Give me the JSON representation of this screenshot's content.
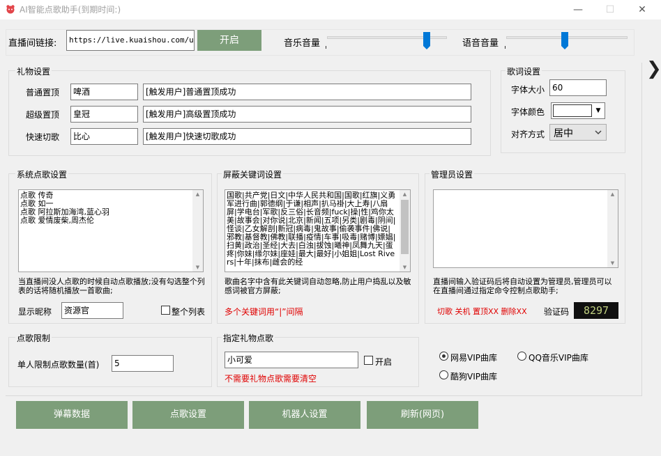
{
  "window": {
    "title": "AI智能点歌助手(到期时间:)",
    "minimize": "—",
    "maximize": "☐",
    "close": "✕"
  },
  "topbar": {
    "url_label": "直播间链接:",
    "url_value": "https://live.kuaishou.com/u/3x",
    "start_button": "开启",
    "music_volume_label": "音乐音量",
    "voice_volume_label": "语音音量",
    "music_volume_level": 0.85,
    "voice_volume_level": 0.48
  },
  "side_arrow": "❯",
  "gift_settings": {
    "title": "礼物设置",
    "rows": [
      {
        "label": "普通置顶",
        "gift": "啤酒",
        "message": "[触发用户]普通置顶成功"
      },
      {
        "label": "超级置顶",
        "gift": "皇冠",
        "message": "[触发用户]高级置顶成功"
      },
      {
        "label": "快速切歌",
        "gift": "比心",
        "message": "[触发用户]快速切歌成功"
      }
    ]
  },
  "lyrics_settings": {
    "title": "歌词设置",
    "font_size_label": "字体大小",
    "font_size_value": "60",
    "font_color_label": "字体颜色",
    "align_label": "对齐方式",
    "align_value": "居中"
  },
  "system_songs": {
    "title": "系统点歌设置",
    "lines": [
      "点歌 传奇",
      "点歌 如一",
      "点歌 阿拉斯加海湾,蓝心羽",
      "点歌 爱情废柴,周杰伦"
    ],
    "hint": "当直播间没人点歌的时候自动点歌播放;没有勾选整个列表的话将随机播放一首歌曲;",
    "nickname_label": "显示昵称",
    "nickname_value": "资源官",
    "whole_list_label": "整个列表"
  },
  "blocked_keywords": {
    "title": "屏蔽关键词设置",
    "text": "国歌|共产党|日文|中华人民共和国|国歌|红旗|义勇军进行曲|郭德纲|于谦|相声|扒马褂|大上寿|八扇屏|学电台|军歌|反三俗|长音频|fuck|操|性|鸡你太美|故事会|对你说|北京|新闻|五项|另类|剧毒|阴间|怪谈|乙女解剖|新冠|病毒|鬼故事|偷袭事件|佛说|邪教|基督教|佛教|联播|疫情|车事|吸毒|赌博|嫖娼|扫黄|政治|圣经|大去|白浊|拔蚀|曦神|凤舞九天|蛋疼|你妹|缘尔妹|座娃|最大|最好|小姐姐|Lost Rivers|十年|抹布|雌会的经",
    "hint": "歌曲名字中含有此关键词自动忽略,防止用户捣乱以及敏感词被官方屏蔽;",
    "red_hint": "多个关键词用“|”间隔"
  },
  "admin_settings": {
    "title": "管理员设置",
    "hint": "直播间输入验证码后将自动设置为管理员,管理员可以在直播间通过指定命令控制点歌助手;",
    "commands": "切歌 关机 置顶XX 删除XX",
    "code_label": "验证码",
    "code_value": "8297"
  },
  "song_limit": {
    "title": "点歌限制",
    "label": "单人限制点歌数量(首)",
    "value": "5"
  },
  "gift_song": {
    "title": "指定礼物点歌",
    "value": "小可爱",
    "enable_label": "开启",
    "red_hint": "不需要礼物点歌需要清空"
  },
  "vip_sources": [
    {
      "label": "网易VIP曲库",
      "selected": true
    },
    {
      "label": "QQ音乐VIP曲库",
      "selected": false
    },
    {
      "label": "酷狗VIP曲库",
      "selected": false
    }
  ],
  "bottom_buttons": [
    "弹幕数据",
    "点歌设置",
    "机器人设置",
    "刷新(网页)"
  ]
}
